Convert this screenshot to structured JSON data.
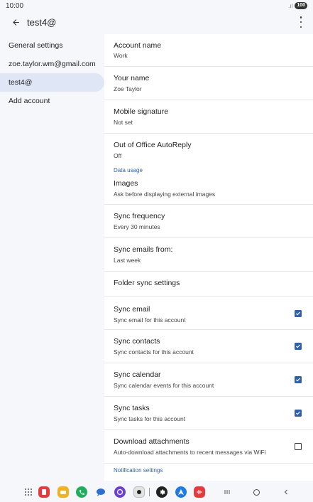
{
  "status": {
    "time": "10:00",
    "battery": "100"
  },
  "appbar": {
    "title": "test4@"
  },
  "left_nav": [
    {
      "label": "General settings",
      "selected": false
    },
    {
      "label": "zoe.taylor.wm@gmail.com",
      "selected": false
    },
    {
      "label": "test4@",
      "selected": true
    },
    {
      "label": "Add account",
      "selected": false
    }
  ],
  "settings": {
    "account_name": {
      "title": "Account name",
      "value": "Work"
    },
    "your_name": {
      "title": "Your name",
      "value": "Zoe Taylor"
    },
    "mobile_signature": {
      "title": "Mobile signature",
      "value": "Not set"
    },
    "out_of_office": {
      "title": "Out of Office AutoReply",
      "value": "Off"
    },
    "data_usage_header": "Data usage",
    "images": {
      "title": "Images",
      "value": "Ask before displaying external images"
    },
    "sync_frequency": {
      "title": "Sync frequency",
      "value": "Every 30 minutes"
    },
    "sync_emails_from": {
      "title": "Sync emails from:",
      "value": "Last week"
    },
    "folder_sync": {
      "title": "Folder sync settings"
    },
    "sync_email": {
      "title": "Sync email",
      "value": "Sync email for this account",
      "checked": true
    },
    "sync_contacts": {
      "title": "Sync contacts",
      "value": "Sync contacts for this account",
      "checked": true
    },
    "sync_calendar": {
      "title": "Sync calendar",
      "value": "Sync calendar events for this account",
      "checked": true
    },
    "sync_tasks": {
      "title": "Sync tasks",
      "value": "Sync tasks for this account",
      "checked": true
    },
    "download_attachments": {
      "title": "Download attachments",
      "value": "Auto-download attachments to recent messages via WiFi",
      "checked": false
    },
    "notification_header": "Notification settings"
  },
  "colors": {
    "accent": "#2f5fb0",
    "selected_bg": "#dfe7f7",
    "background": "#f6f7fb"
  }
}
